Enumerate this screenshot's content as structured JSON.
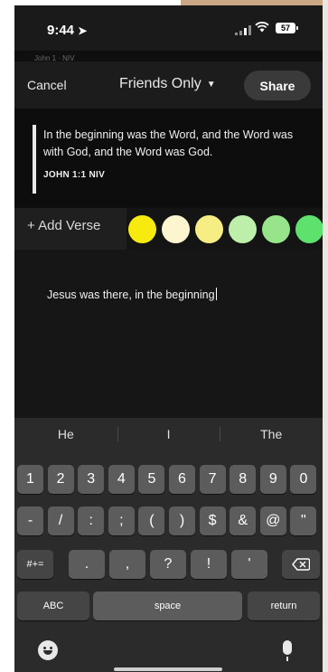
{
  "status": {
    "time": "9:44",
    "battery": "57"
  },
  "ghost_ref": "John 1 · NIV",
  "nav": {
    "cancel": "Cancel",
    "audience": "Friends Only",
    "share": "Share"
  },
  "verse": {
    "text": "In the beginning was the Word, and the Word was with God, and the Word was God.",
    "reference": "JOHN 1:1 NIV"
  },
  "add_verse": "+ Add Verse",
  "highlight_colors": [
    "#f7ea0f",
    "#fdf5d0",
    "#f6ee85",
    "#bdeeaa",
    "#98e48a",
    "#5ee26d"
  ],
  "note": {
    "text": "Jesus was there, in the beginning"
  },
  "keyboard": {
    "suggestions": [
      "He",
      "I",
      "The"
    ],
    "row1": [
      "1",
      "2",
      "3",
      "4",
      "5",
      "6",
      "7",
      "8",
      "9",
      "0"
    ],
    "row2": [
      "-",
      "/",
      ":",
      ";",
      "(",
      ")",
      "$",
      "&",
      "@",
      "\""
    ],
    "row3_mode": "#+=",
    "row3": [
      ".",
      ",",
      "?",
      "!",
      "'"
    ],
    "abc": "ABC",
    "space": "space",
    "return": "return"
  }
}
